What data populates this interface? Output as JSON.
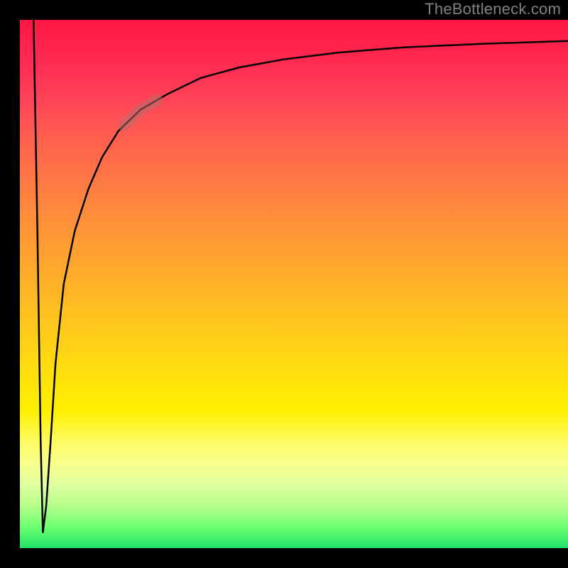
{
  "watermark": "TheBottleneck.com",
  "colors": {
    "page_bg": "#000000",
    "curve": "#000000",
    "marker": "rgba(180,110,110,0.55)",
    "watermark_text": "#808080"
  },
  "chart_data": {
    "type": "line",
    "title": "",
    "xlabel": "",
    "ylabel": "",
    "xlim": [
      0,
      100
    ],
    "ylim": [
      0,
      100
    ],
    "grid": false,
    "legend": false,
    "series": [
      {
        "name": "bottleneck-curve",
        "x": [
          2.5,
          3.2,
          3.8,
          4.2,
          4.8,
          5.6,
          6.5,
          8.0,
          10.0,
          12.5,
          15.0,
          18.0,
          22.0,
          27.0,
          33.0,
          40.0,
          48.0,
          58.0,
          70.0,
          85.0,
          100.0
        ],
        "y": [
          100,
          60,
          20,
          3,
          8,
          20,
          35,
          50,
          60,
          68,
          74,
          79,
          83,
          86,
          89,
          91,
          92.5,
          93.8,
          94.8,
          95.5,
          96.0
        ]
      }
    ],
    "marker": {
      "series": "bottleneck-curve",
      "x_range": [
        19,
        25
      ],
      "approx_y_range": [
        80,
        85
      ]
    },
    "gradient_stops_pct": [
      {
        "pos": 0,
        "color": "#ff1744"
      },
      {
        "pos": 26,
        "color": "#ff6b4a"
      },
      {
        "pos": 56,
        "color": "#ffc21f"
      },
      {
        "pos": 74,
        "color": "#fff000"
      },
      {
        "pos": 100,
        "color": "#22e36a"
      }
    ]
  }
}
